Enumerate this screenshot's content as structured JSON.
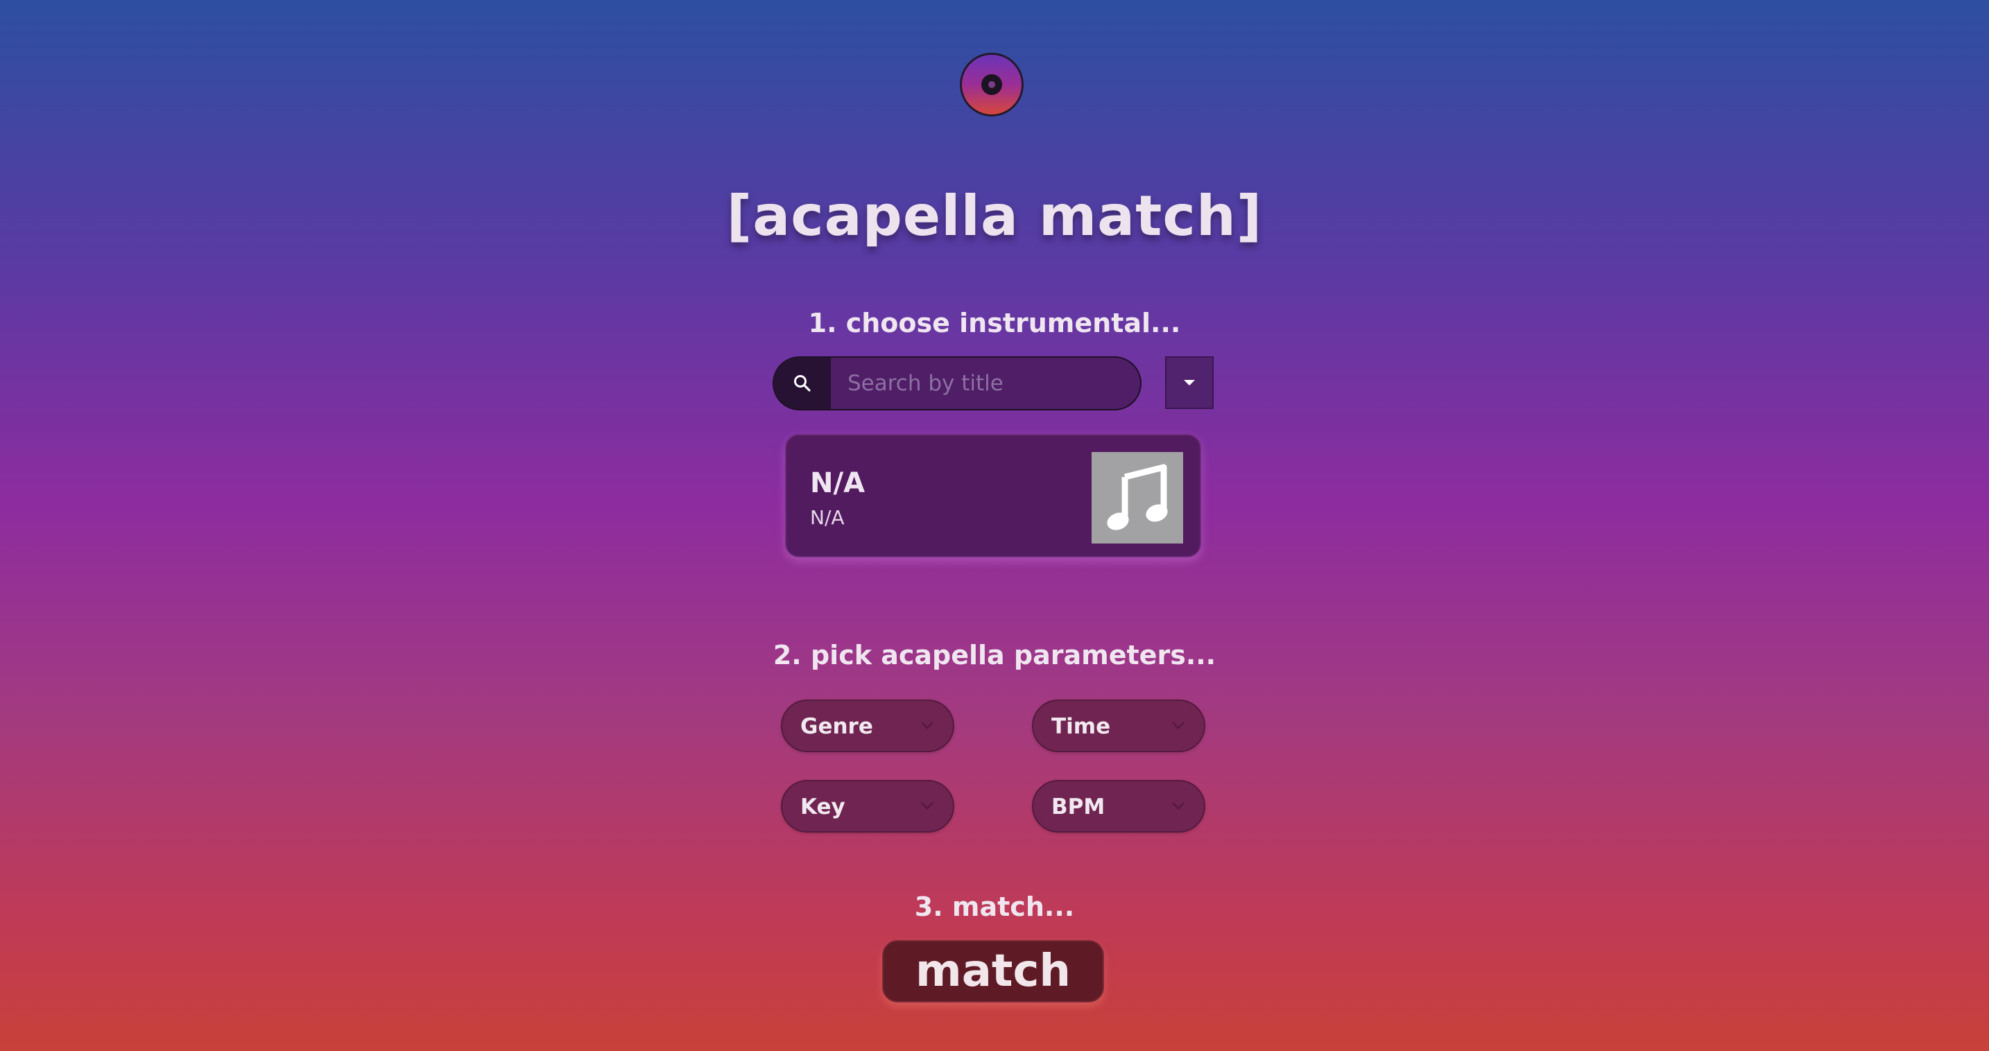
{
  "app": {
    "title": "[acapella match]"
  },
  "steps": {
    "step1": "1. choose instrumental...",
    "step2": "2. pick acapella parameters...",
    "step3": "3. match..."
  },
  "search": {
    "placeholder": "Search by title",
    "value": ""
  },
  "selected_track": {
    "title": "N/A",
    "artist": "N/A",
    "art_icon": "music-note-icon"
  },
  "parameters": {
    "genre": "Genre",
    "time": "Time",
    "key": "Key",
    "bpm": "BPM"
  },
  "match_button": {
    "label": "match"
  },
  "colors": {
    "gradient_top": "#2d4fa2",
    "gradient_mid": "#8d2c9f",
    "gradient_bottom": "#c84139",
    "card_bg": "#521a5f",
    "param_bg": "#6f2451",
    "match_bg": "#5e1b26"
  }
}
